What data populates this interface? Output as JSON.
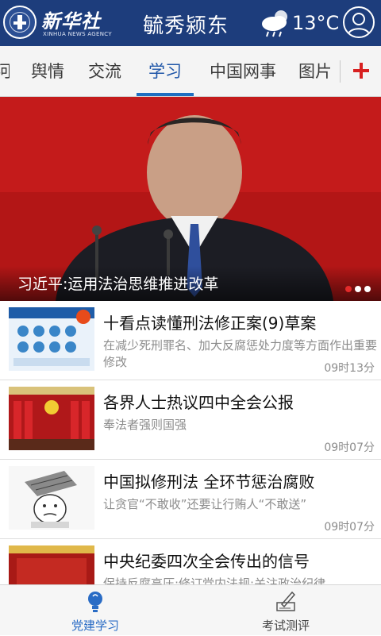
{
  "header": {
    "logo_name": "新华社",
    "logo_subtitle": "XINHUA NEWS AGENCY",
    "title": "毓秀颍东",
    "weather": {
      "icon": "cloud-rain-sun-icon",
      "temperature": "13°C"
    },
    "user_icon": "user-icon"
  },
  "tabs": [
    {
      "label": "河"
    },
    {
      "label": "舆情"
    },
    {
      "label": "交流"
    },
    {
      "label": "学习",
      "active": true
    },
    {
      "label": "中国网事"
    },
    {
      "label": "图片"
    }
  ],
  "add_tab_icon": "plus-icon",
  "banner": {
    "caption": "习近平:运用法治思维推进改革",
    "dots": 3,
    "active_dot": 1
  },
  "news": [
    {
      "title": "十看点读懂刑法修正案(9)草案",
      "summary": "在减少死刑罪名、加大反腐惩处力度等方面作出重要修改",
      "time": "09时13分"
    },
    {
      "title": "各界人士热议四中全会公报",
      "summary": "奉法者强则国强",
      "time": "09时07分"
    },
    {
      "title": "中国拟修刑法 全环节惩治腐败",
      "summary": "让贪官“不敢收”还要让行贿人“不敢送”",
      "time": "09时07分"
    },
    {
      "title": "中央纪委四次全会传出的信号",
      "summary": "保持反腐高压;修订党内法规;关注政治纪律",
      "time": ""
    }
  ],
  "bottom_nav": [
    {
      "label": "党建学习",
      "icon": "bulb-icon",
      "active": true
    },
    {
      "label": "考试测评",
      "icon": "exam-pen-icon",
      "active": false
    }
  ],
  "colors": {
    "header_bg": "#1d3d7c",
    "tab_active": "#1f56a8",
    "tab_underline": "#1f6fc1",
    "add_tab": "#d82020",
    "nav_active": "#2a6cc5"
  }
}
